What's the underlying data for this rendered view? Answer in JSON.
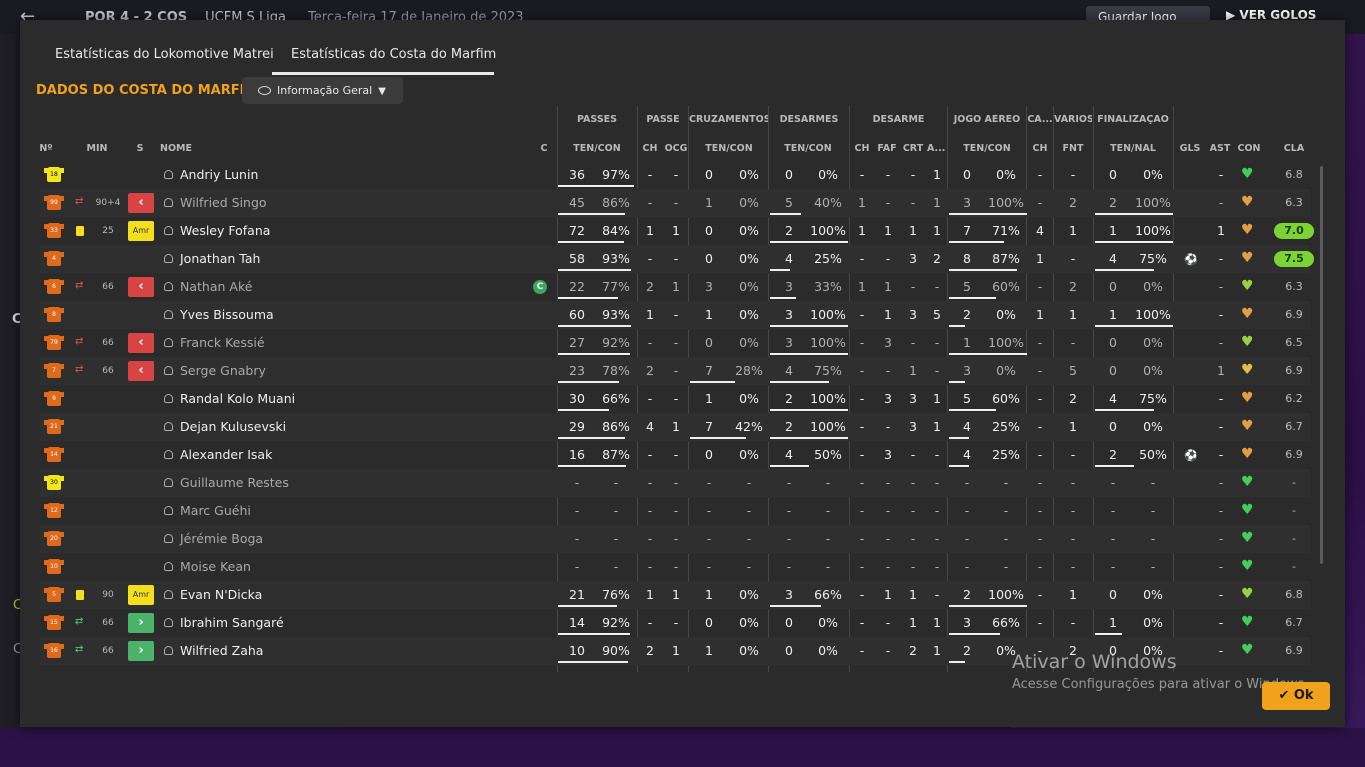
{
  "topbar": {
    "score": "POR  4 - 2  COS",
    "competition": "UCFM S Liga",
    "date": "Terça-feira 17 de Janeiro de 2023",
    "save_button": "Guardar Jogo",
    "goals_button": "VER GOLOS"
  },
  "side": {
    "c1": "C",
    "c2": "C",
    "c3": "C"
  },
  "tabs": [
    "Estatísticas do Lokomotive Matrei",
    "Estatísticas do Costa do Marfim"
  ],
  "active_tab": 1,
  "section_title": "DADOS DO COSTA DO MARFIM",
  "view_dropdown": "Informação Geral",
  "column_groups": {
    "passes": "PASSES",
    "passe": "PASSE",
    "cruzamentos": "CRUZAMENTOS",
    "desarmes": "DESARMES",
    "desarme": "DESARME",
    "jogo_aereo": "JOGO AÉREO",
    "ca": "CA...",
    "varios": "VÁRIOS",
    "finalizacao": "FINALIZAÇÃO"
  },
  "columns": {
    "num": "Nº",
    "min": "MIN",
    "s": "S",
    "name": "NOME",
    "c": "C",
    "pas": "TEN/CON",
    "ch1": "CH",
    "ocg": "OCG",
    "cru": "TEN/CON",
    "des": "TEN/CON",
    "ch2": "CH",
    "faf": "FAF",
    "crt": "CRT",
    "a": "A...",
    "aer": "TEN/CON",
    "ch3": "CH",
    "fnt": "FNT",
    "fin": "TEN/NAL",
    "gls": "GLS",
    "ast": "AST",
    "con": "CON",
    "cla": "CLA"
  },
  "rows": [
    {
      "num": "18",
      "gk": true,
      "card": false,
      "sub": "",
      "min": "",
      "badge": "",
      "name": "Andriy Lunin",
      "dim": false,
      "capt": false,
      "pas": [
        "36",
        "97%"
      ],
      "ch1": "-",
      "ocg": "-",
      "cru": [
        "0",
        "0%"
      ],
      "des": [
        "0",
        "0%"
      ],
      "ch2": "-",
      "faf": "-",
      "crt": "-",
      "a": "1",
      "aer": [
        "0",
        "0%"
      ],
      "ch3": "-",
      "fnt": "-",
      "fin": [
        "0",
        "0%"
      ],
      "gls": "",
      "ast": "-",
      "con": "#3fd05a",
      "cla": "6.8",
      "hi": false
    },
    {
      "num": "99",
      "gk": false,
      "card": false,
      "sub": "out",
      "min": "90+4",
      "badge": "out",
      "name": "Wilfried Singo",
      "dim": true,
      "capt": false,
      "pas": [
        "45",
        "86%"
      ],
      "ch1": "-",
      "ocg": "-",
      "cru": [
        "1",
        "0%"
      ],
      "des": [
        "5",
        "40%"
      ],
      "ch2": "1",
      "faf": "-",
      "crt": "-",
      "a": "1",
      "aer": [
        "3",
        "100%"
      ],
      "ch3": "-",
      "fnt": "2",
      "fin": [
        "2",
        "100%"
      ],
      "gls": "",
      "ast": "-",
      "con": "#e0a040",
      "cla": "6.3",
      "hi": false
    },
    {
      "num": "33",
      "gk": false,
      "card": true,
      "sub": "",
      "min": "25",
      "badge": "amr",
      "name": "Wesley Fofana",
      "dim": false,
      "capt": false,
      "pas": [
        "72",
        "84%"
      ],
      "ch1": "1",
      "ocg": "1",
      "cru": [
        "0",
        "0%"
      ],
      "des": [
        "2",
        "100%"
      ],
      "ch2": "1",
      "faf": "1",
      "crt": "1",
      "a": "1",
      "aer": [
        "7",
        "71%"
      ],
      "ch3": "4",
      "fnt": "1",
      "fin": [
        "1",
        "100%"
      ],
      "gls": "",
      "ast": "1",
      "con": "#e0a040",
      "cla": "7.0",
      "hi": true
    },
    {
      "num": "4",
      "gk": false,
      "card": false,
      "sub": "",
      "min": "",
      "badge": "",
      "name": "Jonathan Tah",
      "dim": false,
      "capt": false,
      "pas": [
        "58",
        "93%"
      ],
      "ch1": "-",
      "ocg": "-",
      "cru": [
        "0",
        "0%"
      ],
      "des": [
        "4",
        "25%"
      ],
      "ch2": "-",
      "faf": "-",
      "crt": "3",
      "a": "2",
      "aer": [
        "8",
        "87%"
      ],
      "ch3": "1",
      "fnt": "-",
      "fin": [
        "4",
        "75%"
      ],
      "gls": "⚽",
      "ast": "-",
      "con": "#e0a040",
      "cla": "7.5",
      "hi": true
    },
    {
      "num": "6",
      "gk": false,
      "card": false,
      "sub": "out",
      "min": "66",
      "badge": "out",
      "name": "Nathan Aké",
      "dim": true,
      "capt": true,
      "pas": [
        "22",
        "77%"
      ],
      "ch1": "2",
      "ocg": "1",
      "cru": [
        "3",
        "0%"
      ],
      "des": [
        "3",
        "33%"
      ],
      "ch2": "1",
      "faf": "1",
      "crt": "-",
      "a": "-",
      "aer": [
        "5",
        "60%"
      ],
      "ch3": "-",
      "fnt": "2",
      "fin": [
        "0",
        "0%"
      ],
      "gls": "",
      "ast": "-",
      "con": "#9ad040",
      "cla": "6.3",
      "hi": false
    },
    {
      "num": "8",
      "gk": false,
      "card": false,
      "sub": "",
      "min": "",
      "badge": "",
      "name": "Yves Bissouma",
      "dim": false,
      "capt": false,
      "pas": [
        "60",
        "93%"
      ],
      "ch1": "1",
      "ocg": "-",
      "cru": [
        "1",
        "0%"
      ],
      "des": [
        "3",
        "100%"
      ],
      "ch2": "-",
      "faf": "1",
      "crt": "3",
      "a": "5",
      "aer": [
        "2",
        "0%"
      ],
      "ch3": "1",
      "fnt": "1",
      "fin": [
        "1",
        "100%"
      ],
      "gls": "",
      "ast": "-",
      "con": "#e0a040",
      "cla": "6.9",
      "hi": false
    },
    {
      "num": "79",
      "gk": false,
      "card": false,
      "sub": "out",
      "min": "66",
      "badge": "out",
      "name": "Franck Kessié",
      "dim": true,
      "capt": false,
      "pas": [
        "27",
        "92%"
      ],
      "ch1": "-",
      "ocg": "-",
      "cru": [
        "0",
        "0%"
      ],
      "des": [
        "3",
        "100%"
      ],
      "ch2": "-",
      "faf": "3",
      "crt": "-",
      "a": "-",
      "aer": [
        "1",
        "100%"
      ],
      "ch3": "-",
      "fnt": "-",
      "fin": [
        "0",
        "0%"
      ],
      "gls": "",
      "ast": "-",
      "con": "#9ad040",
      "cla": "6.5",
      "hi": false
    },
    {
      "num": "7",
      "gk": false,
      "card": false,
      "sub": "out",
      "min": "66",
      "badge": "out",
      "name": "Serge Gnabry",
      "dim": true,
      "capt": false,
      "pas": [
        "23",
        "78%"
      ],
      "ch1": "2",
      "ocg": "-",
      "cru": [
        "7",
        "28%"
      ],
      "des": [
        "4",
        "75%"
      ],
      "ch2": "-",
      "faf": "-",
      "crt": "1",
      "a": "-",
      "aer": [
        "3",
        "0%"
      ],
      "ch3": "-",
      "fnt": "5",
      "fin": [
        "0",
        "0%"
      ],
      "gls": "",
      "ast": "1",
      "con": "#e0c040",
      "cla": "6.9",
      "hi": false
    },
    {
      "num": "9",
      "gk": false,
      "card": false,
      "sub": "",
      "min": "",
      "badge": "",
      "name": "Randal Kolo Muani",
      "dim": false,
      "capt": false,
      "pas": [
        "30",
        "66%"
      ],
      "ch1": "-",
      "ocg": "-",
      "cru": [
        "1",
        "0%"
      ],
      "des": [
        "2",
        "100%"
      ],
      "ch2": "-",
      "faf": "3",
      "crt": "3",
      "a": "1",
      "aer": [
        "5",
        "60%"
      ],
      "ch3": "-",
      "fnt": "2",
      "fin": [
        "4",
        "75%"
      ],
      "gls": "",
      "ast": "-",
      "con": "#e0a040",
      "cla": "6.2",
      "hi": false
    },
    {
      "num": "21",
      "gk": false,
      "card": false,
      "sub": "",
      "min": "",
      "badge": "",
      "name": "Dejan Kulusevski",
      "dim": false,
      "capt": false,
      "pas": [
        "29",
        "86%"
      ],
      "ch1": "4",
      "ocg": "1",
      "cru": [
        "7",
        "42%"
      ],
      "des": [
        "2",
        "100%"
      ],
      "ch2": "-",
      "faf": "-",
      "crt": "3",
      "a": "1",
      "aer": [
        "4",
        "25%"
      ],
      "ch3": "-",
      "fnt": "1",
      "fin": [
        "0",
        "0%"
      ],
      "gls": "",
      "ast": "-",
      "con": "#e0a040",
      "cla": "6.7",
      "hi": false
    },
    {
      "num": "14",
      "gk": false,
      "card": false,
      "sub": "",
      "min": "",
      "badge": "",
      "name": "Alexander Isak",
      "dim": false,
      "capt": false,
      "pas": [
        "16",
        "87%"
      ],
      "ch1": "-",
      "ocg": "-",
      "cru": [
        "0",
        "0%"
      ],
      "des": [
        "4",
        "50%"
      ],
      "ch2": "-",
      "faf": "3",
      "crt": "-",
      "a": "-",
      "aer": [
        "4",
        "25%"
      ],
      "ch3": "-",
      "fnt": "-",
      "fin": [
        "2",
        "50%"
      ],
      "gls": "⚽",
      "ast": "-",
      "con": "#e0a040",
      "cla": "6.9",
      "hi": false
    },
    {
      "num": "30",
      "gk": true,
      "card": false,
      "sub": "",
      "min": "",
      "badge": "",
      "name": "Guillaume Restes",
      "dim": true,
      "capt": false,
      "pas": [
        "-",
        "-"
      ],
      "ch1": "-",
      "ocg": "-",
      "cru": [
        "-",
        "-"
      ],
      "des": [
        "-",
        "-"
      ],
      "ch2": "-",
      "faf": "-",
      "crt": "-",
      "a": "-",
      "aer": [
        "-",
        "-"
      ],
      "ch3": "-",
      "fnt": "-",
      "fin": [
        "-",
        "-"
      ],
      "gls": "",
      "ast": "-",
      "con": "#3fd05a",
      "cla": "-",
      "hi": false
    },
    {
      "num": "12",
      "gk": false,
      "card": false,
      "sub": "",
      "min": "",
      "badge": "",
      "name": "Marc Guéhi",
      "dim": true,
      "capt": false,
      "pas": [
        "-",
        "-"
      ],
      "ch1": "-",
      "ocg": "-",
      "cru": [
        "-",
        "-"
      ],
      "des": [
        "-",
        "-"
      ],
      "ch2": "-",
      "faf": "-",
      "crt": "-",
      "a": "-",
      "aer": [
        "-",
        "-"
      ],
      "ch3": "-",
      "fnt": "-",
      "fin": [
        "-",
        "-"
      ],
      "gls": "",
      "ast": "-",
      "con": "#3fd05a",
      "cla": "-",
      "hi": false
    },
    {
      "num": "20",
      "gk": false,
      "card": false,
      "sub": "",
      "min": "",
      "badge": "",
      "name": "Jérémie Boga",
      "dim": true,
      "capt": false,
      "pas": [
        "-",
        "-"
      ],
      "ch1": "-",
      "ocg": "-",
      "cru": [
        "-",
        "-"
      ],
      "des": [
        "-",
        "-"
      ],
      "ch2": "-",
      "faf": "-",
      "crt": "-",
      "a": "-",
      "aer": [
        "-",
        "-"
      ],
      "ch3": "-",
      "fnt": "-",
      "fin": [
        "-",
        "-"
      ],
      "gls": "",
      "ast": "-",
      "con": "#3fd05a",
      "cla": "-",
      "hi": false
    },
    {
      "num": "10",
      "gk": false,
      "card": false,
      "sub": "",
      "min": "",
      "badge": "",
      "name": "Moise Kean",
      "dim": true,
      "capt": false,
      "pas": [
        "-",
        "-"
      ],
      "ch1": "-",
      "ocg": "-",
      "cru": [
        "-",
        "-"
      ],
      "des": [
        "-",
        "-"
      ],
      "ch2": "-",
      "faf": "-",
      "crt": "-",
      "a": "-",
      "aer": [
        "-",
        "-"
      ],
      "ch3": "-",
      "fnt": "-",
      "fin": [
        "-",
        "-"
      ],
      "gls": "",
      "ast": "-",
      "con": "#3fd05a",
      "cla": "-",
      "hi": false
    },
    {
      "num": "5",
      "gk": false,
      "card": true,
      "sub": "",
      "min": "90",
      "badge": "amr",
      "name": "Evan N'Dicka",
      "dim": false,
      "capt": false,
      "pas": [
        "21",
        "76%"
      ],
      "ch1": "1",
      "ocg": "1",
      "cru": [
        "1",
        "0%"
      ],
      "des": [
        "3",
        "66%"
      ],
      "ch2": "-",
      "faf": "1",
      "crt": "1",
      "a": "-",
      "aer": [
        "2",
        "100%"
      ],
      "ch3": "-",
      "fnt": "1",
      "fin": [
        "0",
        "0%"
      ],
      "gls": "",
      "ast": "-",
      "con": "#9ad040",
      "cla": "6.8",
      "hi": false
    },
    {
      "num": "15",
      "gk": false,
      "card": false,
      "sub": "in",
      "min": "66",
      "badge": "in",
      "name": "Ibrahim Sangaré",
      "dim": false,
      "capt": false,
      "pas": [
        "14",
        "92%"
      ],
      "ch1": "-",
      "ocg": "-",
      "cru": [
        "0",
        "0%"
      ],
      "des": [
        "0",
        "0%"
      ],
      "ch2": "-",
      "faf": "-",
      "crt": "1",
      "a": "1",
      "aer": [
        "3",
        "66%"
      ],
      "ch3": "-",
      "fnt": "-",
      "fin": [
        "1",
        "0%"
      ],
      "gls": "",
      "ast": "-",
      "con": "#3fd05a",
      "cla": "6.7",
      "hi": false
    },
    {
      "num": "16",
      "gk": false,
      "card": false,
      "sub": "in",
      "min": "66",
      "badge": "in",
      "name": "Wilfried Zaha",
      "dim": false,
      "capt": false,
      "pas": [
        "10",
        "90%"
      ],
      "ch1": "2",
      "ocg": "1",
      "cru": [
        "1",
        "0%"
      ],
      "des": [
        "0",
        "0%"
      ],
      "ch2": "-",
      "faf": "-",
      "crt": "2",
      "a": "1",
      "aer": [
        "2",
        "0%"
      ],
      "ch3": "-",
      "fnt": "2",
      "fin": [
        "0",
        "0%"
      ],
      "gls": "",
      "ast": "-",
      "con": "#3fd05a",
      "cla": "6.9",
      "hi": false
    }
  ],
  "windows": {
    "line1": "Ativar o Windows",
    "line2": "Acesse Configurações para ativar o Windows."
  },
  "ok_button": "Ok"
}
